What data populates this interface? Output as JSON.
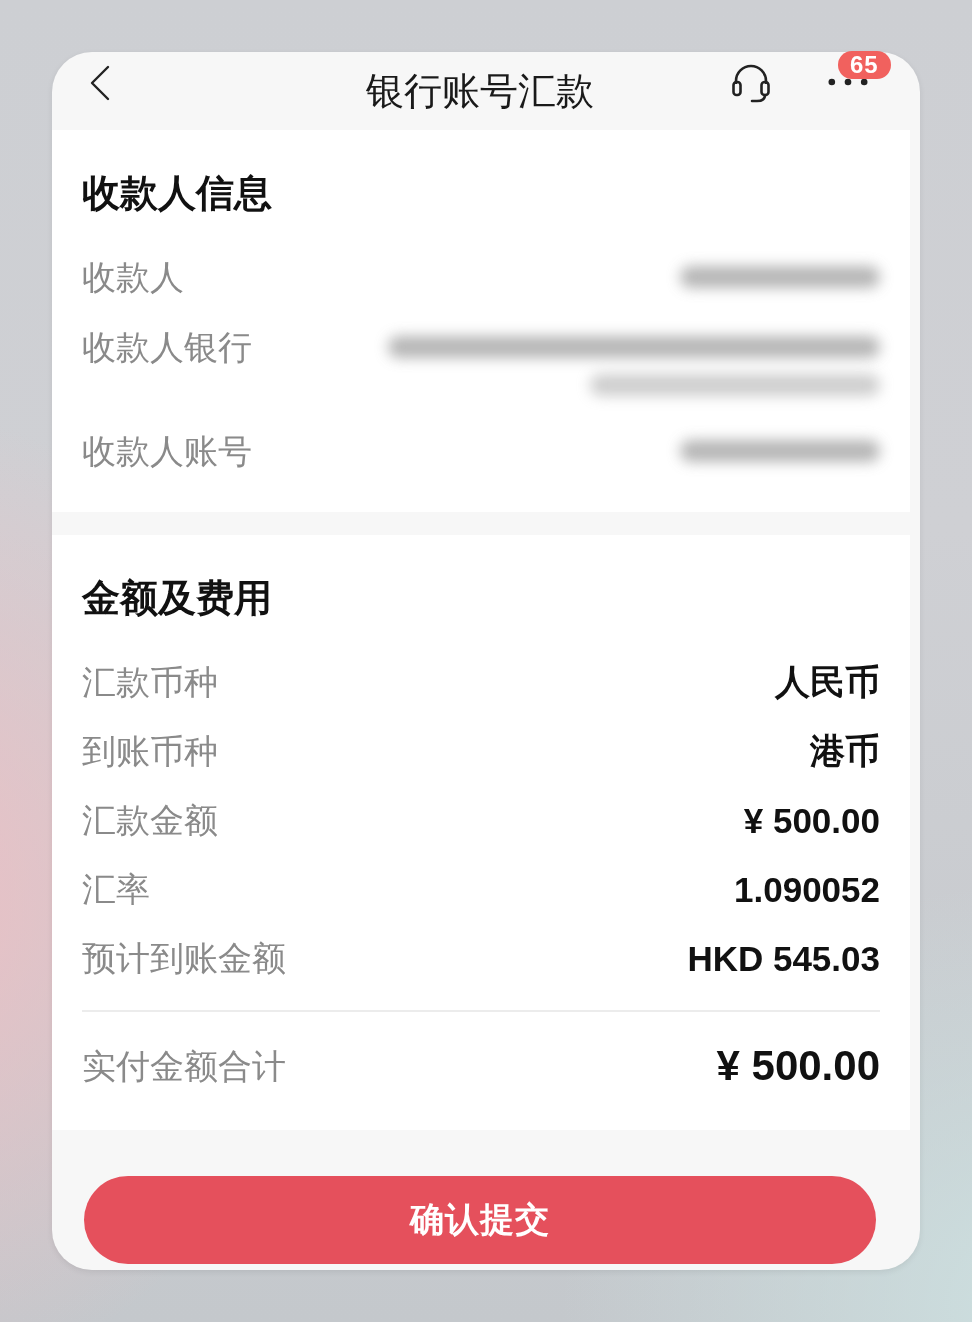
{
  "header": {
    "title": "银行账号汇款",
    "badge": "65"
  },
  "payee_section": {
    "title": "收款人信息",
    "rows": [
      {
        "label": "收款人",
        "kind": "single"
      },
      {
        "label": "收款人银行",
        "kind": "wrapped"
      },
      {
        "label": "收款人账号",
        "kind": "single"
      }
    ]
  },
  "amount_section": {
    "title": "金额及费用",
    "rows": [
      {
        "label": "汇款币种",
        "value": "人民币"
      },
      {
        "label": "到账币种",
        "value": "港币"
      },
      {
        "label": "汇款金额",
        "value": "¥ 500.00"
      },
      {
        "label": "汇率",
        "value": "1.090052"
      },
      {
        "label": "预计到账金额",
        "value": "HKD 545.03"
      }
    ],
    "total": {
      "label": "实付金额合计",
      "value": "¥ 500.00"
    }
  },
  "submit_button": "确认提交"
}
